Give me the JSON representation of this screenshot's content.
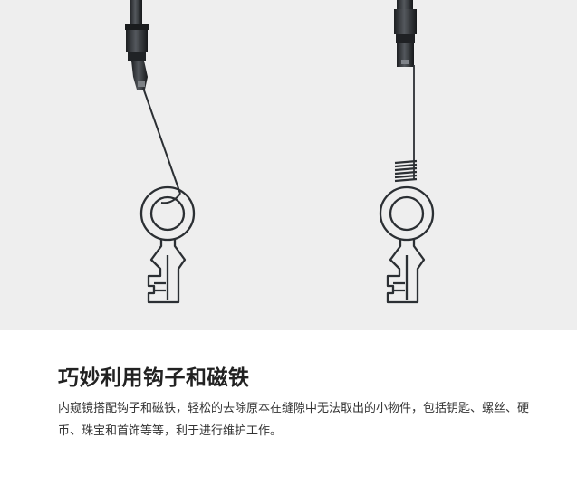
{
  "feature": {
    "title": "巧妙利用钩子和磁铁",
    "description": "内窥镜搭配钩子和磁铁，轻松的去除原本在缝隙中无法取出的小物件，包括钥匙、螺丝、硬币、珠宝和首饰等等，利于进行维护工作。"
  },
  "colors": {
    "illustration_bg": "#eeeeee",
    "outline": "#2b2f33",
    "text_title": "#222222",
    "text_body": "#333333"
  },
  "icons": [
    "endoscope-probe-icon",
    "hook-icon",
    "magnet-icon",
    "key-icon"
  ]
}
